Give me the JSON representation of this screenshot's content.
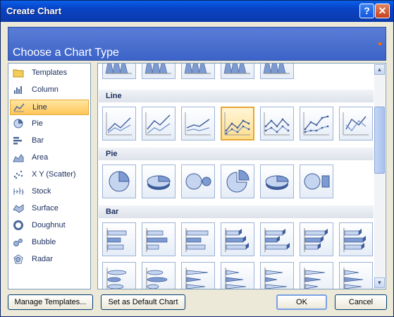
{
  "window": {
    "title": "Create Chart"
  },
  "title_buttons": {
    "help": "?",
    "close": "✕"
  },
  "header": {
    "text": "Choose a Chart Type"
  },
  "categories": [
    {
      "label": "Templates",
      "icon": "folder-icon"
    },
    {
      "label": "Column",
      "icon": "column-chart-icon"
    },
    {
      "label": "Line",
      "icon": "line-chart-icon"
    },
    {
      "label": "Pie",
      "icon": "pie-chart-icon"
    },
    {
      "label": "Bar",
      "icon": "bar-chart-icon"
    },
    {
      "label": "Area",
      "icon": "area-chart-icon"
    },
    {
      "label": "X Y (Scatter)",
      "icon": "scatter-chart-icon"
    },
    {
      "label": "Stock",
      "icon": "stock-chart-icon"
    },
    {
      "label": "Surface",
      "icon": "surface-chart-icon"
    },
    {
      "label": "Doughnut",
      "icon": "doughnut-chart-icon"
    },
    {
      "label": "Bubble",
      "icon": "bubble-chart-icon"
    },
    {
      "label": "Radar",
      "icon": "radar-chart-icon"
    }
  ],
  "selected_category": "Line",
  "sections": [
    {
      "label": "Line",
      "chart_type": "line",
      "thumb_count": 7,
      "selected_index": 3
    },
    {
      "label": "Pie",
      "chart_type": "pie",
      "thumb_count": 6
    },
    {
      "label": "Bar",
      "chart_type": "bar",
      "thumb_count": 14
    }
  ],
  "buttons": {
    "manage_templates": "Manage Templates...",
    "set_default": "Set as Default Chart",
    "ok": "OK",
    "cancel": "Cancel"
  },
  "colors": {
    "accent_selected": "#ffc659",
    "title_blue": "#0a3aa9",
    "header_blue": "#4a6fd0"
  }
}
